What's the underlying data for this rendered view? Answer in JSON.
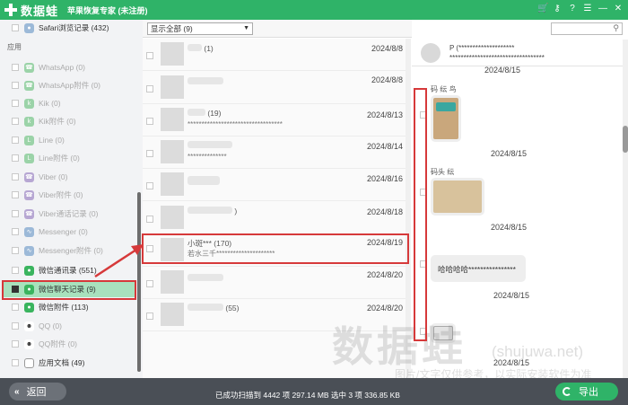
{
  "app": {
    "logo_text": "数据蛙",
    "title": "苹果恢复专家 (未注册)",
    "controls": [
      "cart-icon",
      "key-icon",
      "help-icon",
      "menu-icon",
      "minimize-icon",
      "close-icon"
    ]
  },
  "sidebar": {
    "top_item": "Safari浏览记录 (432)",
    "section": "应用",
    "items": [
      {
        "label": "WhatsApp (0)",
        "icon": "whatsapp-icon"
      },
      {
        "label": "WhatsApp附件 (0)",
        "icon": "whatsapp-icon"
      },
      {
        "label": "Kik (0)",
        "icon": "kik-icon"
      },
      {
        "label": "Kik附件 (0)",
        "icon": "kik-icon"
      },
      {
        "label": "Line (0)",
        "icon": "line-icon"
      },
      {
        "label": "Line附件 (0)",
        "icon": "line-icon"
      },
      {
        "label": "Viber (0)",
        "icon": "viber-icon"
      },
      {
        "label": "Viber附件 (0)",
        "icon": "viber-icon"
      },
      {
        "label": "Viber通话记录 (0)",
        "icon": "viber-icon"
      },
      {
        "label": "Messenger (0)",
        "icon": "messenger-icon"
      },
      {
        "label": "Messenger附件 (0)",
        "icon": "messenger-icon"
      },
      {
        "label": "微信通讯录 (551)",
        "icon": "wechat-icon"
      },
      {
        "label": "微信聊天记录 (9)",
        "icon": "wechat-icon"
      },
      {
        "label": "微信附件 (113)",
        "icon": "wechat-icon"
      },
      {
        "label": "QQ (0)",
        "icon": "qq-icon"
      },
      {
        "label": "QQ附件 (0)",
        "icon": "qq-icon"
      },
      {
        "label": "应用文档 (49)",
        "icon": "document-icon"
      }
    ]
  },
  "filter": {
    "selected": "显示全部 (9)"
  },
  "list": {
    "rows": [
      {
        "name": "(1)",
        "preview": "",
        "date": "2024/8/8"
      },
      {
        "name": "",
        "preview": "",
        "date": "2024/8/8"
      },
      {
        "name": "(19)",
        "preview": "**********************************",
        "date": "2024/8/13"
      },
      {
        "name": "",
        "preview": "**************",
        "date": "2024/8/14"
      },
      {
        "name": "",
        "preview": "",
        "date": "2024/8/16"
      },
      {
        "name": ")",
        "preview": "",
        "date": "2024/8/18"
      },
      {
        "name": "小斑*** (170)",
        "preview": "若水三千*********************",
        "date": "2024/8/19"
      },
      {
        "name": "",
        "preview": "",
        "date": "2024/8/20"
      },
      {
        "name": "(55)",
        "preview": "",
        "date": "2024/8/20"
      }
    ]
  },
  "chat": {
    "header_line1": "P          (********************",
    "header_line2": "**********************************",
    "dates": [
      "2024/8/15",
      "2024/8/15",
      "2024/8/15",
      "2024/8/15",
      "2024/8/15"
    ],
    "msg1_name": "码        纭  鸟",
    "msg2_name": "码头       纭",
    "msg3_text": "哈哈哈哈****************"
  },
  "watermark": {
    "main": "数据蛙",
    "site": "(shujuwa.net)",
    "note": "图片/文字仅供参考，以实际安装软件为准"
  },
  "bottom": {
    "back_label": "返回",
    "status": "已成功扫描到 4442 项 297.14 MB  选中 3 项 336.85 KB",
    "export_label": "导出"
  },
  "colors": {
    "brand_green": "#2fb368",
    "highlight_red": "#d6393a",
    "selected_bg": "#a8e1bd",
    "bottom_bar": "#4a4f56"
  }
}
